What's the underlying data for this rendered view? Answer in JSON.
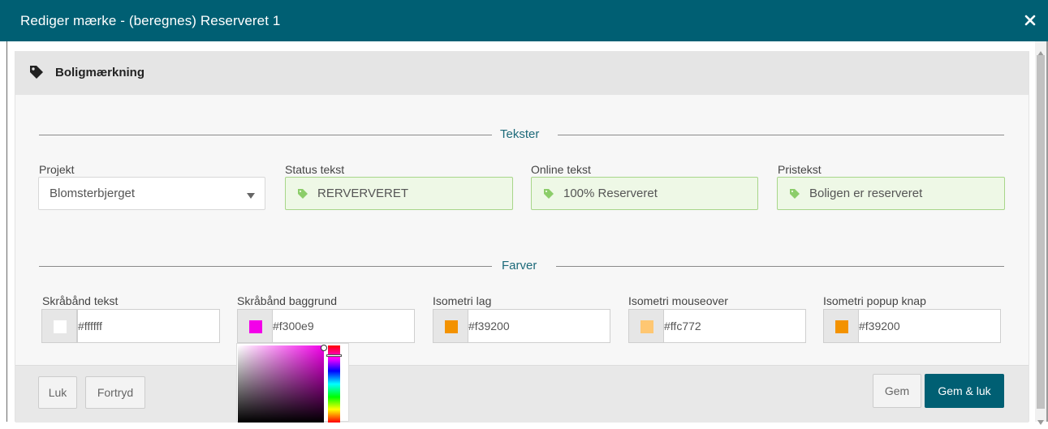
{
  "dialog": {
    "title": "Rediger mærke - (beregnes) Reserveret 1",
    "close_icon": "close-icon"
  },
  "section": {
    "title": "Boligmærkning",
    "icon": "tag-icon"
  },
  "tekster": {
    "heading": "Tekster",
    "projekt": {
      "label": "Projekt",
      "value": "Blomsterbjerget"
    },
    "status_tekst": {
      "label": "Status tekst",
      "value": "RERVERVERET"
    },
    "online_tekst": {
      "label": "Online tekst",
      "value": "100% Reserveret"
    },
    "pristekst": {
      "label": "Pristekst",
      "value": "Boligen er reserveret"
    }
  },
  "farver": {
    "heading": "Farver",
    "items": [
      {
        "label": "Skråbånd tekst",
        "value": "#ffffff",
        "color": "#ffffff"
      },
      {
        "label": "Skråbånd baggrund",
        "value": "#f300e9",
        "color": "#f300e9"
      },
      {
        "label": "Isometri lag",
        "value": "#f39200",
        "color": "#f39200"
      },
      {
        "label": "Isometri mouseover",
        "value": "#ffc772",
        "color": "#ffc772"
      },
      {
        "label": "Isometri popup knap",
        "value": "#f39200",
        "color": "#f39200"
      }
    ]
  },
  "footer": {
    "luk": "Luk",
    "fortryd": "Fortryd",
    "gem": "Gem",
    "gem_luk": "Gem & luk"
  },
  "colors": {
    "header_bg": "#005f73",
    "accent_text": "#1d6a7a",
    "valid_bg": "#eef8e6",
    "valid_border": "#a8d68a"
  }
}
